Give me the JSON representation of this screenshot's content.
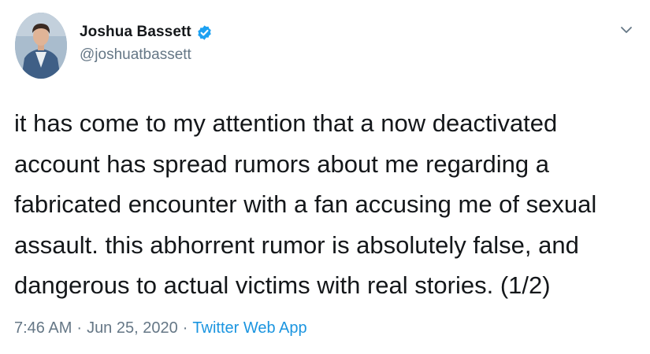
{
  "author": {
    "display_name": "Joshua Bassett",
    "handle": "@joshuatbassett",
    "verified": true
  },
  "icons": {
    "avatar": "avatar-photo",
    "verified": "verified-badge-icon",
    "menu": "chevron-down-icon"
  },
  "tweet": {
    "lines": [
      "it has come to my attention that a now deactivated",
      "account has spread rumors about me regarding a",
      "fabricated encounter with a fan accusing me of sexual",
      "assault. this abhorrent rumor is absolutely false, and",
      "dangerous to actual victims with real stories. (1/2)"
    ]
  },
  "meta": {
    "time": "7:46 AM",
    "separator": "·",
    "date": "Jun 25, 2020",
    "source": "Twitter Web App"
  },
  "colors": {
    "text": "#14171a",
    "secondary": "#657786",
    "accent": "#1b95e0",
    "verified": "#1da1f2"
  }
}
